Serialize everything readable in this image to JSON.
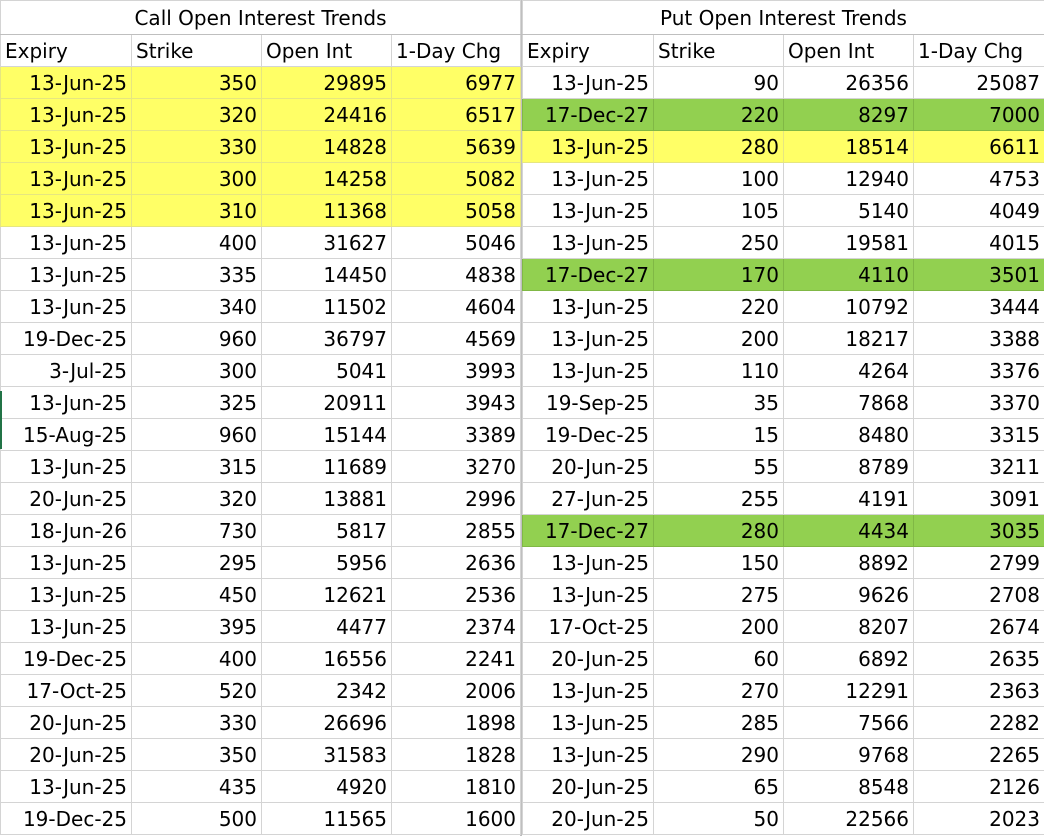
{
  "calls": {
    "title": "Call Open Interest Trends",
    "columns": [
      "Expiry",
      "Strike",
      "Open Int",
      "1-Day Chg"
    ],
    "rows": [
      {
        "expiry": "13-Jun-25",
        "strike": "350",
        "oi": "29895",
        "chg": "6977",
        "highlight": "yellow"
      },
      {
        "expiry": "13-Jun-25",
        "strike": "320",
        "oi": "24416",
        "chg": "6517",
        "highlight": "yellow"
      },
      {
        "expiry": "13-Jun-25",
        "strike": "330",
        "oi": "14828",
        "chg": "5639",
        "highlight": "yellow"
      },
      {
        "expiry": "13-Jun-25",
        "strike": "300",
        "oi": "14258",
        "chg": "5082",
        "highlight": "yellow"
      },
      {
        "expiry": "13-Jun-25",
        "strike": "310",
        "oi": "11368",
        "chg": "5058",
        "highlight": "yellow"
      },
      {
        "expiry": "13-Jun-25",
        "strike": "400",
        "oi": "31627",
        "chg": "5046",
        "highlight": ""
      },
      {
        "expiry": "13-Jun-25",
        "strike": "335",
        "oi": "14450",
        "chg": "4838",
        "highlight": ""
      },
      {
        "expiry": "13-Jun-25",
        "strike": "340",
        "oi": "11502",
        "chg": "4604",
        "highlight": ""
      },
      {
        "expiry": "19-Dec-25",
        "strike": "960",
        "oi": "36797",
        "chg": "4569",
        "highlight": ""
      },
      {
        "expiry": "3-Jul-25",
        "strike": "300",
        "oi": "5041",
        "chg": "3993",
        "highlight": ""
      },
      {
        "expiry": "13-Jun-25",
        "strike": "325",
        "oi": "20911",
        "chg": "3943",
        "highlight": ""
      },
      {
        "expiry": "15-Aug-25",
        "strike": "960",
        "oi": "15144",
        "chg": "3389",
        "highlight": ""
      },
      {
        "expiry": "13-Jun-25",
        "strike": "315",
        "oi": "11689",
        "chg": "3270",
        "highlight": ""
      },
      {
        "expiry": "20-Jun-25",
        "strike": "320",
        "oi": "13881",
        "chg": "2996",
        "highlight": ""
      },
      {
        "expiry": "18-Jun-26",
        "strike": "730",
        "oi": "5817",
        "chg": "2855",
        "highlight": ""
      },
      {
        "expiry": "13-Jun-25",
        "strike": "295",
        "oi": "5956",
        "chg": "2636",
        "highlight": ""
      },
      {
        "expiry": "13-Jun-25",
        "strike": "450",
        "oi": "12621",
        "chg": "2536",
        "highlight": ""
      },
      {
        "expiry": "13-Jun-25",
        "strike": "395",
        "oi": "4477",
        "chg": "2374",
        "highlight": ""
      },
      {
        "expiry": "19-Dec-25",
        "strike": "400",
        "oi": "16556",
        "chg": "2241",
        "highlight": ""
      },
      {
        "expiry": "17-Oct-25",
        "strike": "520",
        "oi": "2342",
        "chg": "2006",
        "highlight": ""
      },
      {
        "expiry": "20-Jun-25",
        "strike": "330",
        "oi": "26696",
        "chg": "1898",
        "highlight": ""
      },
      {
        "expiry": "20-Jun-25",
        "strike": "350",
        "oi": "31583",
        "chg": "1828",
        "highlight": ""
      },
      {
        "expiry": "13-Jun-25",
        "strike": "435",
        "oi": "4920",
        "chg": "1810",
        "highlight": ""
      },
      {
        "expiry": "19-Dec-25",
        "strike": "500",
        "oi": "11565",
        "chg": "1600",
        "highlight": ""
      }
    ]
  },
  "puts": {
    "title": "Put Open Interest Trends",
    "columns": [
      "Expiry",
      "Strike",
      "Open Int",
      "1-Day Chg"
    ],
    "rows": [
      {
        "expiry": "13-Jun-25",
        "strike": "90",
        "oi": "26356",
        "chg": "25087",
        "highlight": ""
      },
      {
        "expiry": "17-Dec-27",
        "strike": "220",
        "oi": "8297",
        "chg": "7000",
        "highlight": "green"
      },
      {
        "expiry": "13-Jun-25",
        "strike": "280",
        "oi": "18514",
        "chg": "6611",
        "highlight": "yellow"
      },
      {
        "expiry": "13-Jun-25",
        "strike": "100",
        "oi": "12940",
        "chg": "4753",
        "highlight": ""
      },
      {
        "expiry": "13-Jun-25",
        "strike": "105",
        "oi": "5140",
        "chg": "4049",
        "highlight": ""
      },
      {
        "expiry": "13-Jun-25",
        "strike": "250",
        "oi": "19581",
        "chg": "4015",
        "highlight": ""
      },
      {
        "expiry": "17-Dec-27",
        "strike": "170",
        "oi": "4110",
        "chg": "3501",
        "highlight": "green"
      },
      {
        "expiry": "13-Jun-25",
        "strike": "220",
        "oi": "10792",
        "chg": "3444",
        "highlight": ""
      },
      {
        "expiry": "13-Jun-25",
        "strike": "200",
        "oi": "18217",
        "chg": "3388",
        "highlight": ""
      },
      {
        "expiry": "13-Jun-25",
        "strike": "110",
        "oi": "4264",
        "chg": "3376",
        "highlight": ""
      },
      {
        "expiry": "19-Sep-25",
        "strike": "35",
        "oi": "7868",
        "chg": "3370",
        "highlight": ""
      },
      {
        "expiry": "19-Dec-25",
        "strike": "15",
        "oi": "8480",
        "chg": "3315",
        "highlight": ""
      },
      {
        "expiry": "20-Jun-25",
        "strike": "55",
        "oi": "8789",
        "chg": "3211",
        "highlight": ""
      },
      {
        "expiry": "27-Jun-25",
        "strike": "255",
        "oi": "4191",
        "chg": "3091",
        "highlight": ""
      },
      {
        "expiry": "17-Dec-27",
        "strike": "280",
        "oi": "4434",
        "chg": "3035",
        "highlight": "green"
      },
      {
        "expiry": "13-Jun-25",
        "strike": "150",
        "oi": "8892",
        "chg": "2799",
        "highlight": ""
      },
      {
        "expiry": "13-Jun-25",
        "strike": "275",
        "oi": "9626",
        "chg": "2708",
        "highlight": ""
      },
      {
        "expiry": "17-Oct-25",
        "strike": "200",
        "oi": "8207",
        "chg": "2674",
        "highlight": ""
      },
      {
        "expiry": "20-Jun-25",
        "strike": "60",
        "oi": "6892",
        "chg": "2635",
        "highlight": ""
      },
      {
        "expiry": "13-Jun-25",
        "strike": "270",
        "oi": "12291",
        "chg": "2363",
        "highlight": ""
      },
      {
        "expiry": "13-Jun-25",
        "strike": "285",
        "oi": "7566",
        "chg": "2282",
        "highlight": ""
      },
      {
        "expiry": "13-Jun-25",
        "strike": "290",
        "oi": "9768",
        "chg": "2265",
        "highlight": ""
      },
      {
        "expiry": "20-Jun-25",
        "strike": "65",
        "oi": "8548",
        "chg": "2126",
        "highlight": ""
      },
      {
        "expiry": "20-Jun-25",
        "strike": "50",
        "oi": "22566",
        "chg": "2023",
        "highlight": ""
      }
    ]
  },
  "colors": {
    "yellow_highlight": "#ffff66",
    "green_highlight": "#92d050",
    "gridline": "#d4d4d4"
  }
}
